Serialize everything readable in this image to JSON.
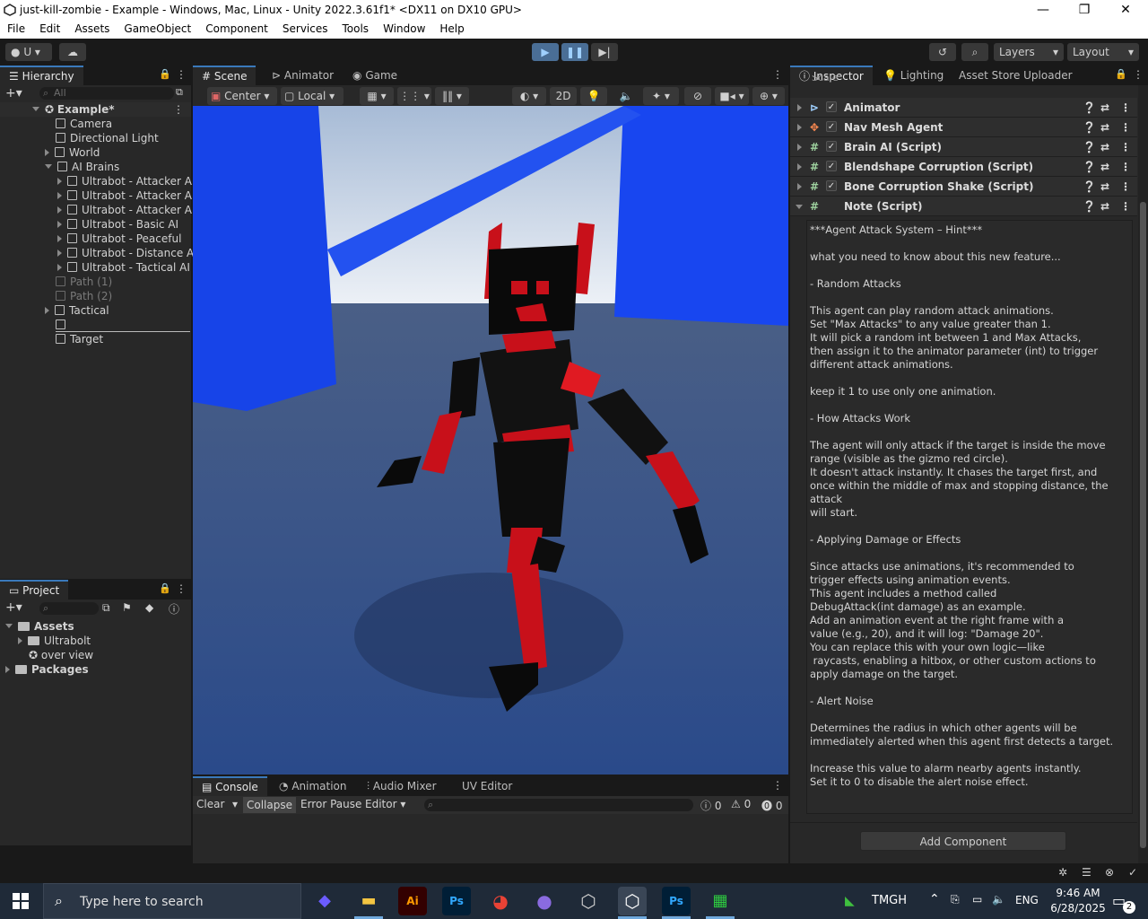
{
  "window": {
    "title": "just-kill-zombie - Example - Windows, Mac, Linux - Unity 2022.3.61f1* <DX11 on DX10 GPU>"
  },
  "menu": [
    "File",
    "Edit",
    "Assets",
    "GameObject",
    "Component",
    "Services",
    "Tools",
    "Window",
    "Help"
  ],
  "toolbar": {
    "account": "U",
    "layers": "Layers",
    "layout": "Layout"
  },
  "hierarchy": {
    "tab": "Hierarchy",
    "search_placeholder": "All",
    "scene": "Example*",
    "items": [
      {
        "label": "Camera"
      },
      {
        "label": "Directional Light"
      },
      {
        "label": "World"
      },
      {
        "label": "AI Brains"
      },
      {
        "label": "Ultrabot - Attacker AI"
      },
      {
        "label": "Ultrabot - Attacker AI"
      },
      {
        "label": "Ultrabot - Attacker AI"
      },
      {
        "label": "Ultrabot - Basic AI"
      },
      {
        "label": "Ultrabot - Peaceful"
      },
      {
        "label": "Ultrabot - Distance AI"
      },
      {
        "label": "Ultrabot - Tactical AI"
      },
      {
        "label": "Path (1)"
      },
      {
        "label": "Path (2)"
      },
      {
        "label": "Tactical"
      },
      {
        "label": ""
      },
      {
        "label": "Target"
      }
    ]
  },
  "project": {
    "tab": "Project",
    "assets": "Assets",
    "items": [
      {
        "label": "Ultrabolt"
      },
      {
        "label": "over view"
      }
    ],
    "packages": "Packages"
  },
  "scene_tabs": [
    "Scene",
    "Animator",
    "Game"
  ],
  "scene_toolbar": {
    "pivot": "Center",
    "space": "Local",
    "mode2d": "2D"
  },
  "console": {
    "tabs": [
      "Console",
      "Animation",
      "Audio Mixer",
      "UV Editor"
    ],
    "clear": "Clear",
    "collapse": "Collapse",
    "error_pause": "Error Pause",
    "editor": "Editor",
    "count_log": "0",
    "count_warn": "0",
    "count_err": "0"
  },
  "inspector": {
    "tabs": [
      "Inspector",
      "Lighting",
      "Asset Store Uploader"
    ],
    "partial_label": "Scale",
    "components": [
      {
        "name": "Animator",
        "icon": "animator-icon"
      },
      {
        "name": "Nav Mesh Agent",
        "icon": "navmesh-icon"
      },
      {
        "name": "Brain AI (Script)",
        "icon": "script-icon"
      },
      {
        "name": "Blendshape Corruption (Script)",
        "icon": "script-icon"
      },
      {
        "name": "Bone Corruption Shake (Script)",
        "icon": "script-icon"
      }
    ],
    "note_title": "Note (Script)",
    "note_text": "***Agent Attack System – Hint***\n\nwhat you need to know about this new feature...\n\n- Random Attacks\n\nThis agent can play random attack animations.\nSet \"Max Attacks\" to any value greater than 1.\nIt will pick a random int between 1 and Max Attacks,\nthen assign it to the animator parameter (int) to trigger\ndifferent attack animations.\n\nkeep it 1 to use only one animation.\n\n- How Attacks Work\n\nThe agent will only attack if the target is inside the move\nrange (visible as the gizmo red circle).\nIt doesn't attack instantly. It chases the target first, and\nonce within the middle of max and stopping distance, the attack\nwill start.\n\n- Applying Damage or Effects\n\nSince attacks use animations, it's recommended to\ntrigger effects using animation events.\nThis agent includes a method called\nDebugAttack(int damage) as an example.\nAdd an animation event at the right frame with a\nvalue (e.g., 20), and it will log: \"Damage 20\".\nYou can replace this with your own logic—like\n raycasts, enabling a hitbox, or other custom actions to\napply damage on the target.\n\n- Alert Noise\n\nDetermines the radius in which other agents will be\nimmediately alerted when this agent first detects a target.\n\nIncrease this value to alarm nearby agents instantly.\nSet it to 0 to disable the alert noise effect.",
    "add_component": "Add Component"
  },
  "taskbar": {
    "search_placeholder": "Type here to search",
    "tray_app": "TMGH",
    "lang": "ENG",
    "time": "9:46 AM",
    "date": "6/28/2025",
    "notif_count": "2",
    "apps": [
      {
        "name": "copilot-icon",
        "label": "",
        "color": "#6b5cff"
      },
      {
        "name": "file-explorer-icon",
        "label": "",
        "color": "#f4c542"
      },
      {
        "name": "illustrator-icon",
        "label": "Ai",
        "color": "#ff9a00"
      },
      {
        "name": "photoshop-icon",
        "label": "Ps",
        "color": "#31a8ff"
      },
      {
        "name": "chrome-icon",
        "label": "",
        "color": "#e94235"
      },
      {
        "name": "github-icon",
        "label": "",
        "color": "#8a6be0"
      },
      {
        "name": "unity-hub-icon",
        "label": "",
        "color": "#cfcfcf"
      },
      {
        "name": "unity-icon",
        "label": "",
        "color": "#ffffff"
      },
      {
        "name": "photoshop-icon",
        "label": "Ps",
        "color": "#31a8ff"
      },
      {
        "name": "game-icon",
        "label": "",
        "color": "#2ecc40"
      }
    ]
  }
}
